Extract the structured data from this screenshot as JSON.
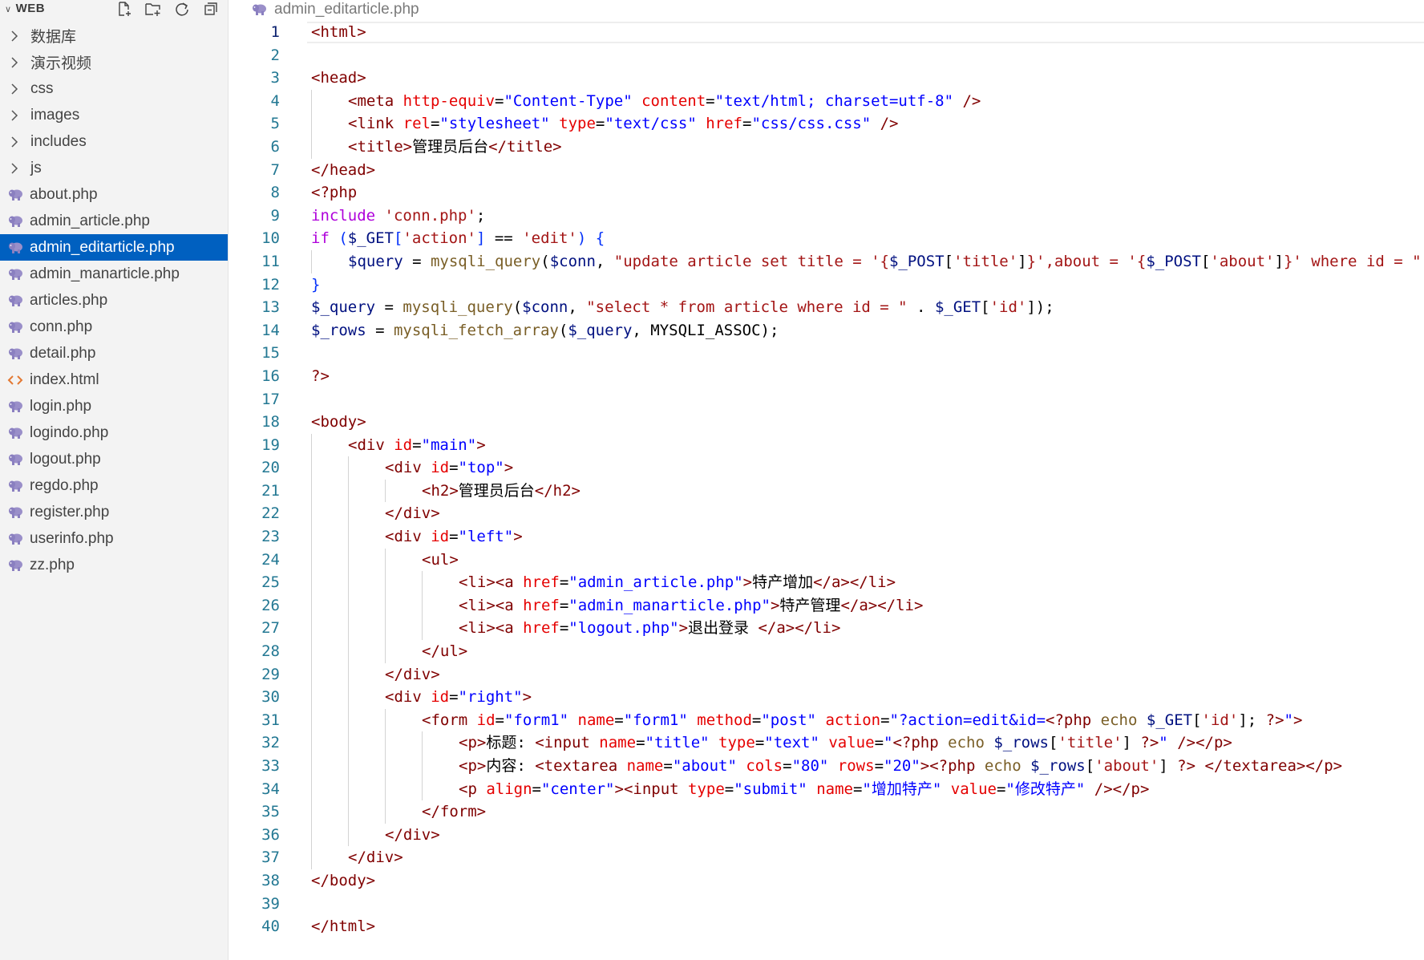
{
  "sidebar": {
    "title": "WEB",
    "actions": [
      {
        "name": "new-file-icon"
      },
      {
        "name": "new-folder-icon"
      },
      {
        "name": "refresh-icon"
      },
      {
        "name": "collapse-all-icon"
      }
    ],
    "items": [
      {
        "label": "数据库",
        "kind": "folder"
      },
      {
        "label": "演示视频",
        "kind": "folder"
      },
      {
        "label": "css",
        "kind": "folder"
      },
      {
        "label": "images",
        "kind": "folder"
      },
      {
        "label": "includes",
        "kind": "folder"
      },
      {
        "label": "js",
        "kind": "folder"
      },
      {
        "label": "about.php",
        "kind": "php"
      },
      {
        "label": "admin_article.php",
        "kind": "php"
      },
      {
        "label": "admin_editarticle.php",
        "kind": "php",
        "active": true
      },
      {
        "label": "admin_manarticle.php",
        "kind": "php"
      },
      {
        "label": "articles.php",
        "kind": "php"
      },
      {
        "label": "conn.php",
        "kind": "php"
      },
      {
        "label": "detail.php",
        "kind": "php"
      },
      {
        "label": "index.html",
        "kind": "html"
      },
      {
        "label": "login.php",
        "kind": "php"
      },
      {
        "label": "logindo.php",
        "kind": "php"
      },
      {
        "label": "logout.php",
        "kind": "php"
      },
      {
        "label": "regdo.php",
        "kind": "php"
      },
      {
        "label": "register.php",
        "kind": "php"
      },
      {
        "label": "userinfo.php",
        "kind": "php"
      },
      {
        "label": "zz.php",
        "kind": "php"
      }
    ]
  },
  "editor": {
    "tab_title": "admin_editarticle.php",
    "current_line": 1,
    "lines": [
      {
        "n": "1",
        "i": 0,
        "t": [
          [
            "tg",
            "<html>"
          ]
        ]
      },
      {
        "n": "2",
        "i": 0,
        "t": []
      },
      {
        "n": "3",
        "i": 0,
        "t": [
          [
            "tg",
            "<head>"
          ]
        ]
      },
      {
        "n": "4",
        "i": 1,
        "t": [
          [
            "tg",
            "<meta "
          ],
          [
            "at",
            "http-equiv"
          ],
          [
            "pu",
            "="
          ],
          [
            "sv",
            "\"Content-Type\""
          ],
          [
            "pu",
            " "
          ],
          [
            "at",
            "content"
          ],
          [
            "pu",
            "="
          ],
          [
            "sv",
            "\"text/html; charset=utf-8\""
          ],
          [
            "tg",
            " />"
          ]
        ]
      },
      {
        "n": "5",
        "i": 1,
        "t": [
          [
            "tg",
            "<link "
          ],
          [
            "at",
            "rel"
          ],
          [
            "pu",
            "="
          ],
          [
            "sv",
            "\"stylesheet\""
          ],
          [
            "pu",
            " "
          ],
          [
            "at",
            "type"
          ],
          [
            "pu",
            "="
          ],
          [
            "sv",
            "\"text/css\""
          ],
          [
            "pu",
            " "
          ],
          [
            "at",
            "href"
          ],
          [
            "pu",
            "="
          ],
          [
            "sv",
            "\"css/css.css\""
          ],
          [
            "tg",
            " />"
          ]
        ]
      },
      {
        "n": "6",
        "i": 1,
        "t": [
          [
            "tg",
            "<title>"
          ],
          [
            "pu",
            "管理员后台"
          ],
          [
            "tg",
            "</title>"
          ]
        ]
      },
      {
        "n": "7",
        "i": 0,
        "t": [
          [
            "tg",
            "</head>"
          ]
        ]
      },
      {
        "n": "8",
        "i": 0,
        "t": [
          [
            "ph",
            "<?php"
          ]
        ]
      },
      {
        "n": "9",
        "i": 0,
        "t": [
          [
            "kw",
            "include"
          ],
          [
            "pu",
            " "
          ],
          [
            "st",
            "'conn.php'"
          ],
          [
            "pu",
            ";"
          ]
        ]
      },
      {
        "n": "10",
        "i": 0,
        "t": [
          [
            "kw",
            "if"
          ],
          [
            "pu",
            " "
          ],
          [
            "bl",
            "("
          ],
          [
            "vr",
            "$_GET"
          ],
          [
            "bl",
            "["
          ],
          [
            "st",
            "'action'"
          ],
          [
            "bl",
            "]"
          ],
          [
            "pu",
            " == "
          ],
          [
            "st",
            "'edit'"
          ],
          [
            "bl",
            ")"
          ],
          [
            "pu",
            " "
          ],
          [
            "bl",
            "{"
          ]
        ]
      },
      {
        "n": "11",
        "i": 1,
        "t": [
          [
            "vr",
            "$query"
          ],
          [
            "pu",
            " = "
          ],
          [
            "fn",
            "mysqli_query"
          ],
          [
            "pu",
            "("
          ],
          [
            "vr",
            "$conn"
          ],
          [
            "pu",
            ", "
          ],
          [
            "st",
            "\"update article set title = '{"
          ],
          [
            "vr",
            "$_POST"
          ],
          [
            "pu",
            "["
          ],
          [
            "st",
            "'title'"
          ],
          [
            "pu",
            "]"
          ],
          [
            "st",
            "}',about = '{"
          ],
          [
            "vr",
            "$_POST"
          ],
          [
            "pu",
            "["
          ],
          [
            "st",
            "'about'"
          ],
          [
            "pu",
            "]"
          ],
          [
            "st",
            "}' where id = \""
          ]
        ]
      },
      {
        "n": "12",
        "i": 0,
        "t": [
          [
            "bl",
            "}"
          ]
        ]
      },
      {
        "n": "13",
        "i": 0,
        "t": [
          [
            "vr",
            "$_query"
          ],
          [
            "pu",
            " = "
          ],
          [
            "fn",
            "mysqli_query"
          ],
          [
            "pu",
            "("
          ],
          [
            "vr",
            "$conn"
          ],
          [
            "pu",
            ", "
          ],
          [
            "st",
            "\"select * from article where id = \""
          ],
          [
            "pu",
            " . "
          ],
          [
            "vr",
            "$_GET"
          ],
          [
            "pu",
            "["
          ],
          [
            "st",
            "'id'"
          ],
          [
            "pu",
            "]);"
          ]
        ]
      },
      {
        "n": "14",
        "i": 0,
        "t": [
          [
            "vr",
            "$_rows"
          ],
          [
            "pu",
            " = "
          ],
          [
            "fn",
            "mysqli_fetch_array"
          ],
          [
            "pu",
            "("
          ],
          [
            "vr",
            "$_query"
          ],
          [
            "pu",
            ", MYSQLI_ASSOC);"
          ]
        ]
      },
      {
        "n": "15",
        "i": 0,
        "t": []
      },
      {
        "n": "16",
        "i": 0,
        "t": [
          [
            "ph",
            "?>"
          ]
        ]
      },
      {
        "n": "17",
        "i": 0,
        "t": []
      },
      {
        "n": "18",
        "i": 0,
        "t": [
          [
            "tg",
            "<body>"
          ]
        ]
      },
      {
        "n": "19",
        "i": 1,
        "t": [
          [
            "tg",
            "<div "
          ],
          [
            "at",
            "id"
          ],
          [
            "pu",
            "="
          ],
          [
            "sv",
            "\"main\""
          ],
          [
            "tg",
            ">"
          ]
        ]
      },
      {
        "n": "20",
        "i": 2,
        "t": [
          [
            "tg",
            "<div "
          ],
          [
            "at",
            "id"
          ],
          [
            "pu",
            "="
          ],
          [
            "sv",
            "\"top\""
          ],
          [
            "tg",
            ">"
          ]
        ]
      },
      {
        "n": "21",
        "i": 3,
        "t": [
          [
            "tg",
            "<h2>"
          ],
          [
            "pu",
            "管理员后台"
          ],
          [
            "tg",
            "</h2>"
          ]
        ]
      },
      {
        "n": "22",
        "i": 2,
        "t": [
          [
            "tg",
            "</div>"
          ]
        ]
      },
      {
        "n": "23",
        "i": 2,
        "t": [
          [
            "tg",
            "<div "
          ],
          [
            "at",
            "id"
          ],
          [
            "pu",
            "="
          ],
          [
            "sv",
            "\"left\""
          ],
          [
            "tg",
            ">"
          ]
        ]
      },
      {
        "n": "24",
        "i": 3,
        "t": [
          [
            "tg",
            "<ul>"
          ]
        ]
      },
      {
        "n": "25",
        "i": 4,
        "t": [
          [
            "tg",
            "<li><a "
          ],
          [
            "at",
            "href"
          ],
          [
            "pu",
            "="
          ],
          [
            "sv",
            "\"admin_article.php\""
          ],
          [
            "tg",
            ">"
          ],
          [
            "pu",
            "特产增加"
          ],
          [
            "tg",
            "</a></li>"
          ]
        ]
      },
      {
        "n": "26",
        "i": 4,
        "t": [
          [
            "tg",
            "<li><a "
          ],
          [
            "at",
            "href"
          ],
          [
            "pu",
            "="
          ],
          [
            "sv",
            "\"admin_manarticle.php\""
          ],
          [
            "tg",
            ">"
          ],
          [
            "pu",
            "特产管理"
          ],
          [
            "tg",
            "</a></li>"
          ]
        ]
      },
      {
        "n": "27",
        "i": 4,
        "t": [
          [
            "tg",
            "<li><a "
          ],
          [
            "at",
            "href"
          ],
          [
            "pu",
            "="
          ],
          [
            "sv",
            "\"logout.php\""
          ],
          [
            "tg",
            ">"
          ],
          [
            "pu",
            "退出登录 "
          ],
          [
            "tg",
            "</a></li>"
          ]
        ]
      },
      {
        "n": "28",
        "i": 3,
        "t": [
          [
            "tg",
            "</ul>"
          ]
        ]
      },
      {
        "n": "29",
        "i": 2,
        "t": [
          [
            "tg",
            "</div>"
          ]
        ]
      },
      {
        "n": "30",
        "i": 2,
        "t": [
          [
            "tg",
            "<div "
          ],
          [
            "at",
            "id"
          ],
          [
            "pu",
            "="
          ],
          [
            "sv",
            "\"right\""
          ],
          [
            "tg",
            ">"
          ]
        ]
      },
      {
        "n": "31",
        "i": 3,
        "t": [
          [
            "tg",
            "<form "
          ],
          [
            "at",
            "id"
          ],
          [
            "pu",
            "="
          ],
          [
            "sv",
            "\"form1\""
          ],
          [
            "pu",
            " "
          ],
          [
            "at",
            "name"
          ],
          [
            "pu",
            "="
          ],
          [
            "sv",
            "\"form1\""
          ],
          [
            "pu",
            " "
          ],
          [
            "at",
            "method"
          ],
          [
            "pu",
            "="
          ],
          [
            "sv",
            "\"post\""
          ],
          [
            "pu",
            " "
          ],
          [
            "at",
            "action"
          ],
          [
            "pu",
            "="
          ],
          [
            "sv",
            "\"?action=edit&id="
          ],
          [
            "ph",
            "<?php"
          ],
          [
            "pu",
            " "
          ],
          [
            "fn",
            "echo"
          ],
          [
            "pu",
            " "
          ],
          [
            "vr",
            "$_GET"
          ],
          [
            "pu",
            "["
          ],
          [
            "st",
            "'id'"
          ],
          [
            "pu",
            "]; "
          ],
          [
            "ph",
            "?>"
          ],
          [
            "sv",
            "\""
          ],
          [
            "tg",
            ">"
          ]
        ]
      },
      {
        "n": "32",
        "i": 4,
        "t": [
          [
            "tg",
            "<p>"
          ],
          [
            "pu",
            "标题: "
          ],
          [
            "tg",
            "<input "
          ],
          [
            "at",
            "name"
          ],
          [
            "pu",
            "="
          ],
          [
            "sv",
            "\"title\""
          ],
          [
            "pu",
            " "
          ],
          [
            "at",
            "type"
          ],
          [
            "pu",
            "="
          ],
          [
            "sv",
            "\"text\""
          ],
          [
            "pu",
            " "
          ],
          [
            "at",
            "value"
          ],
          [
            "pu",
            "="
          ],
          [
            "sv",
            "\""
          ],
          [
            "ph",
            "<?php"
          ],
          [
            "pu",
            " "
          ],
          [
            "fn",
            "echo"
          ],
          [
            "pu",
            " "
          ],
          [
            "vr",
            "$_rows"
          ],
          [
            "pu",
            "["
          ],
          [
            "st",
            "'title'"
          ],
          [
            "pu",
            "] "
          ],
          [
            "ph",
            "?>"
          ],
          [
            "sv",
            "\""
          ],
          [
            "tg",
            " /></p>"
          ]
        ]
      },
      {
        "n": "33",
        "i": 4,
        "t": [
          [
            "tg",
            "<p>"
          ],
          [
            "pu",
            "内容: "
          ],
          [
            "tg",
            "<textarea "
          ],
          [
            "at",
            "name"
          ],
          [
            "pu",
            "="
          ],
          [
            "sv",
            "\"about\""
          ],
          [
            "pu",
            " "
          ],
          [
            "at",
            "cols"
          ],
          [
            "pu",
            "="
          ],
          [
            "sv",
            "\"80\""
          ],
          [
            "pu",
            " "
          ],
          [
            "at",
            "rows"
          ],
          [
            "pu",
            "="
          ],
          [
            "sv",
            "\"20\""
          ],
          [
            "tg",
            ">"
          ],
          [
            "ph",
            "<?php"
          ],
          [
            "pu",
            " "
          ],
          [
            "fn",
            "echo"
          ],
          [
            "pu",
            " "
          ],
          [
            "vr",
            "$_rows"
          ],
          [
            "pu",
            "["
          ],
          [
            "st",
            "'about'"
          ],
          [
            "pu",
            "] "
          ],
          [
            "ph",
            "?>"
          ],
          [
            "pu",
            " "
          ],
          [
            "tg",
            "</textarea></p>"
          ]
        ]
      },
      {
        "n": "34",
        "i": 4,
        "t": [
          [
            "tg",
            "<p "
          ],
          [
            "at",
            "align"
          ],
          [
            "pu",
            "="
          ],
          [
            "sv",
            "\"center\""
          ],
          [
            "tg",
            "><input "
          ],
          [
            "at",
            "type"
          ],
          [
            "pu",
            "="
          ],
          [
            "sv",
            "\"submit\""
          ],
          [
            "pu",
            " "
          ],
          [
            "at",
            "name"
          ],
          [
            "pu",
            "="
          ],
          [
            "sv",
            "\"增加特产\""
          ],
          [
            "pu",
            " "
          ],
          [
            "at",
            "value"
          ],
          [
            "pu",
            "="
          ],
          [
            "sv",
            "\"修改特产\""
          ],
          [
            "tg",
            " /></p>"
          ]
        ]
      },
      {
        "n": "35",
        "i": 3,
        "t": [
          [
            "tg",
            "</form>"
          ]
        ]
      },
      {
        "n": "36",
        "i": 2,
        "t": [
          [
            "tg",
            "</div>"
          ]
        ]
      },
      {
        "n": "37",
        "i": 1,
        "t": [
          [
            "tg",
            "</div>"
          ]
        ]
      },
      {
        "n": "38",
        "i": 0,
        "t": [
          [
            "tg",
            "</body>"
          ]
        ]
      },
      {
        "n": "39",
        "i": 0,
        "t": []
      },
      {
        "n": "40",
        "i": 0,
        "t": [
          [
            "tg",
            "</html>"
          ]
        ]
      }
    ]
  }
}
